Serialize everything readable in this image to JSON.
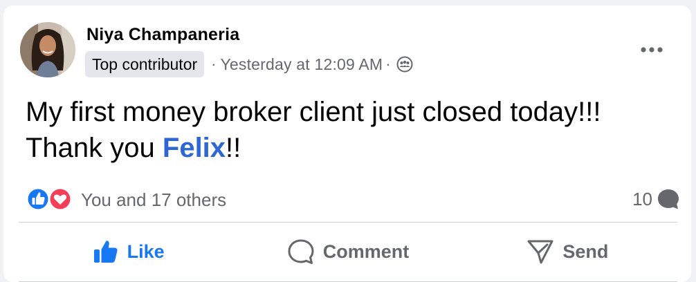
{
  "post": {
    "author": {
      "name": "Niya Champaneria",
      "badge": "Top contributor",
      "avatar_icon": "profile-photo"
    },
    "separator": "·",
    "timestamp": "Yesterday at 12:09 AM",
    "audience_icon": "group-audience-icon",
    "more_icon": "more-options-icon",
    "text_before": "My first money broker client just closed today!!! Thank you ",
    "mention": "Felix",
    "text_after": "!!"
  },
  "engagement": {
    "reaction_icons": [
      "like-reaction-icon",
      "love-reaction-icon"
    ],
    "reaction_summary": "You and 17 others",
    "comment_count": "10",
    "comment_count_icon": "comment-bubble-icon"
  },
  "actions": {
    "like": "Like",
    "comment": "Comment",
    "send": "Send",
    "like_active": true
  },
  "colors": {
    "accent": "#1877f2",
    "mention": "#2e67d3",
    "secondary_text": "#65676b",
    "primary_text": "#050505",
    "love": "#f33e58",
    "badge_bg": "#e4e6eb"
  }
}
